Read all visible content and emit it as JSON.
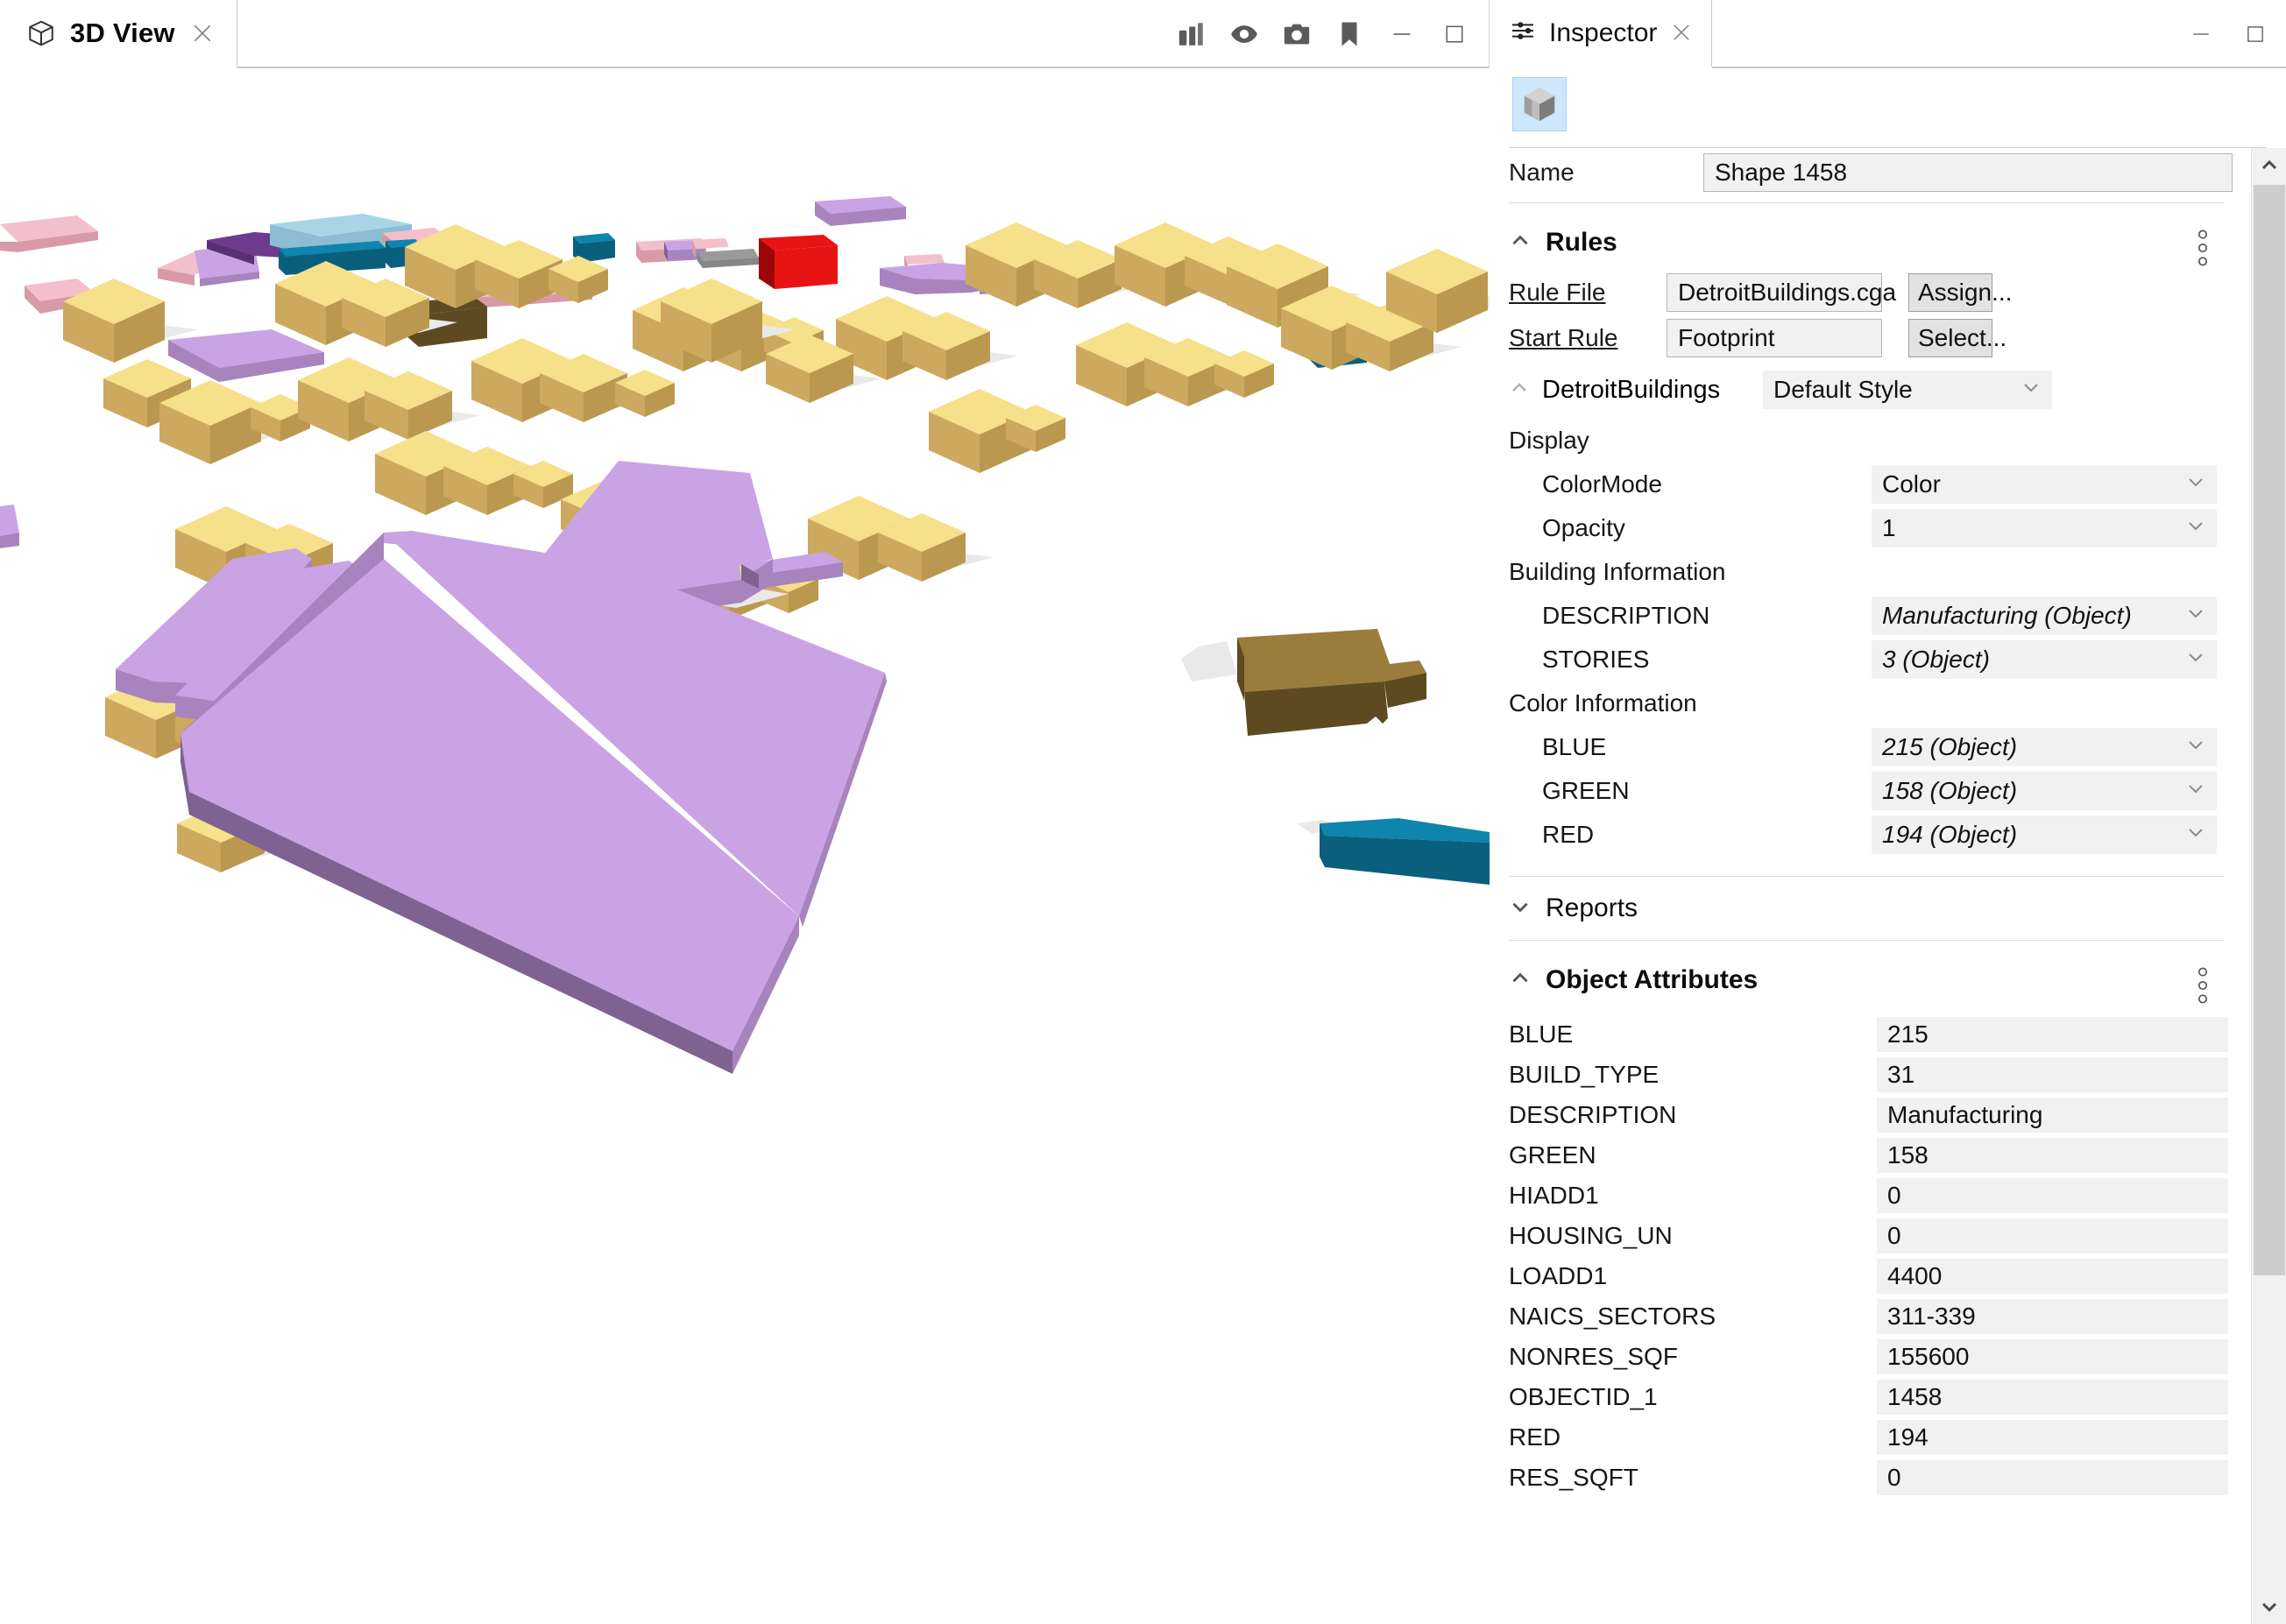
{
  "view": {
    "tab_label": "3D View",
    "tab_icon": "cube-icon",
    "close_icon": "close-icon",
    "toolbar": [
      {
        "name": "layers-icon",
        "label": "Layers"
      },
      {
        "name": "eye-icon",
        "label": "Visibility"
      },
      {
        "name": "camera-icon",
        "label": "Snapshot"
      },
      {
        "name": "bookmark-icon",
        "label": "Bookmark"
      }
    ],
    "minimize_label": "—",
    "maximize_label": "□"
  },
  "inspector": {
    "tab_label": "Inspector",
    "tab_icon": "sliders-icon",
    "close_icon": "close-icon",
    "minimize_label": "—",
    "maximize_label": "□",
    "shape_button_icon": "shape-cube-icon",
    "name_row": {
      "label": "Name",
      "value": "Shape 1458"
    },
    "rules": {
      "title": "Rules",
      "collapse_icon": "chevron-up-icon",
      "kebab_icon": "more-options-icon",
      "rule_file": {
        "label": "Rule File",
        "value": "DetroitBuildings.cga",
        "button": "Assign..."
      },
      "start_rule": {
        "label": "Start Rule",
        "value": "Footprint",
        "button": "Select..."
      },
      "style": {
        "name": "DetroitBuildings",
        "collapse_icon": "chevron-up-icon",
        "selected": "Default Style"
      },
      "groups": [
        {
          "label": "Display",
          "items": [
            {
              "label": "ColorMode",
              "value": "Color",
              "italic": false
            },
            {
              "label": "Opacity",
              "value": "1",
              "italic": false
            }
          ]
        },
        {
          "label": "Building Information",
          "items": [
            {
              "label": "DESCRIPTION",
              "value": "Manufacturing (Object)",
              "italic": true
            },
            {
              "label": "STORIES",
              "value": "3 (Object)",
              "italic": true
            }
          ]
        },
        {
          "label": "Color Information",
          "items": [
            {
              "label": "BLUE",
              "value": "215 (Object)",
              "italic": true
            },
            {
              "label": "GREEN",
              "value": "158 (Object)",
              "italic": true
            },
            {
              "label": "RED",
              "value": "194 (Object)",
              "italic": true
            }
          ]
        }
      ]
    },
    "reports": {
      "title": "Reports",
      "expand_icon": "chevron-down-icon",
      "collapsed": true
    },
    "object_attributes": {
      "title": "Object Attributes",
      "collapse_icon": "chevron-up-icon",
      "kebab_icon": "more-options-icon",
      "rows": [
        {
          "name": "BLUE",
          "value": "215"
        },
        {
          "name": "BUILD_TYPE",
          "value": "31"
        },
        {
          "name": "DESCRIPTION",
          "value": "Manufacturing"
        },
        {
          "name": "GREEN",
          "value": "158"
        },
        {
          "name": "HIADD1",
          "value": "0"
        },
        {
          "name": "HOUSING_UN",
          "value": "0"
        },
        {
          "name": "LOADD1",
          "value": "4400"
        },
        {
          "name": "NAICS_SECTORS",
          "value": "311-339"
        },
        {
          "name": "NONRES_SQF",
          "value": "155600"
        },
        {
          "name": "OBJECTID_1",
          "value": "1458"
        },
        {
          "name": "RED",
          "value": "194"
        },
        {
          "name": "RES_SQFT",
          "value": "0"
        }
      ]
    },
    "scrollbar": {
      "up_icon": "chevron-up-icon",
      "down_icon": "chevron-down-icon"
    }
  },
  "scene": {
    "background": "#ffffff",
    "selected_color_top": "#c9a3e4",
    "selected_color_side": "#a784bd",
    "selected_color_dark": "#7e6291",
    "palette": {
      "yellow_roof": "#f6e08a",
      "yellow_wall": "#cda95f",
      "pink": "#f3bfcc",
      "pink_dark": "#d79aa8",
      "purple": "#6e3b8e",
      "lavender": "#c9a3e4",
      "lightblue": "#a8d5e6",
      "teal": "#0f84ad",
      "teal_dark": "#0a5f7d",
      "red": "#e81414",
      "red_dark": "#9c0606",
      "brown": "#5e4a20",
      "brown_light": "#9a7c3c",
      "gray": "#9a9a9a"
    }
  }
}
